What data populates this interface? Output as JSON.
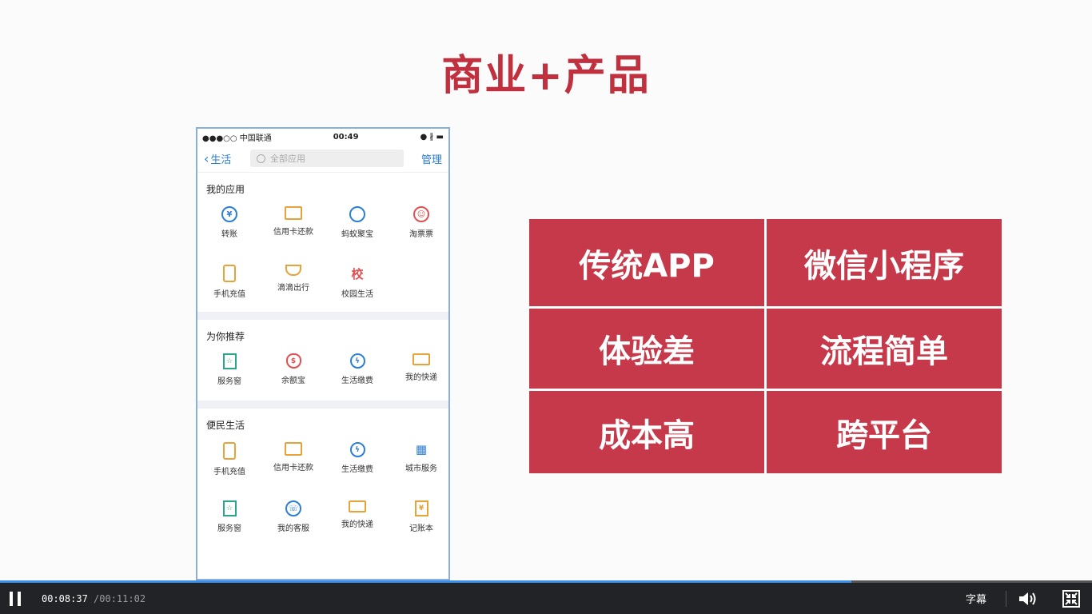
{
  "slide": {
    "title": "商业+产品",
    "phone": {
      "status": {
        "carrier": "●●●○○ 中国联通",
        "time": "00:49",
        "battery": "● ∦ ▬"
      },
      "nav": {
        "back": "生活",
        "search_placeholder": "全部应用",
        "manage": "管理"
      },
      "sections": [
        {
          "title": "我的应用",
          "items": [
            {
              "label": "转账",
              "icon": "yuan-transfer-icon",
              "color": "#2b7fd6"
            },
            {
              "label": "信用卡还款",
              "icon": "credit-card-icon",
              "color": "#e8a23a"
            },
            {
              "label": "蚂蚁聚宝",
              "icon": "ant-fortune-icon",
              "color": "#2b7fd6"
            },
            {
              "label": "淘票票",
              "icon": "taopiaopiao-icon",
              "color": "#e05050"
            },
            {
              "label": "手机充值",
              "icon": "mobile-phone-icon",
              "color": "#e8a23a"
            },
            {
              "label": "滴滴出行",
              "icon": "didi-icon",
              "color": "#e8a23a"
            },
            {
              "label": "校园生活",
              "icon": "campus-icon",
              "color": "#e05050"
            }
          ]
        },
        {
          "title": "为你推荐",
          "items": [
            {
              "label": "服务窗",
              "icon": "service-window-icon",
              "color": "#2aa58a"
            },
            {
              "label": "余额宝",
              "icon": "yuebao-icon",
              "color": "#e05050"
            },
            {
              "label": "生活缴费",
              "icon": "utility-payment-icon",
              "color": "#2b7fd6"
            },
            {
              "label": "我的快递",
              "icon": "delivery-truck-icon",
              "color": "#e8a23a"
            }
          ]
        },
        {
          "title": "便民生活",
          "items": [
            {
              "label": "手机充值",
              "icon": "mobile-phone-icon",
              "color": "#e8a23a"
            },
            {
              "label": "信用卡还款",
              "icon": "credit-card-icon",
              "color": "#e8a23a"
            },
            {
              "label": "生活缴费",
              "icon": "utility-payment-icon",
              "color": "#2b7fd6"
            },
            {
              "label": "城市服务",
              "icon": "city-building-icon",
              "color": "#2b7fd6"
            },
            {
              "label": "服务窗",
              "icon": "service-window-icon",
              "color": "#2aa58a"
            },
            {
              "label": "我的客服",
              "icon": "customer-service-icon",
              "color": "#2b7fd6"
            },
            {
              "label": "我的快递",
              "icon": "delivery-truck-icon",
              "color": "#e8a23a"
            },
            {
              "label": "记账本",
              "icon": "ledger-icon",
              "color": "#e8a23a"
            }
          ]
        }
      ]
    },
    "comparison": [
      [
        "传统APP",
        "微信小程序"
      ],
      [
        "体验差",
        "流程简单"
      ],
      [
        "成本高",
        "跨平台"
      ]
    ],
    "accent_color": "#c6394a"
  },
  "player": {
    "current_time": "00:08:37",
    "total_time": " /00:11:02",
    "progress_fraction": 0.78,
    "subtitles_label": "字幕",
    "volume_icon": "speaker-icon",
    "fullscreen_icon": "exit-fullscreen-icon"
  }
}
